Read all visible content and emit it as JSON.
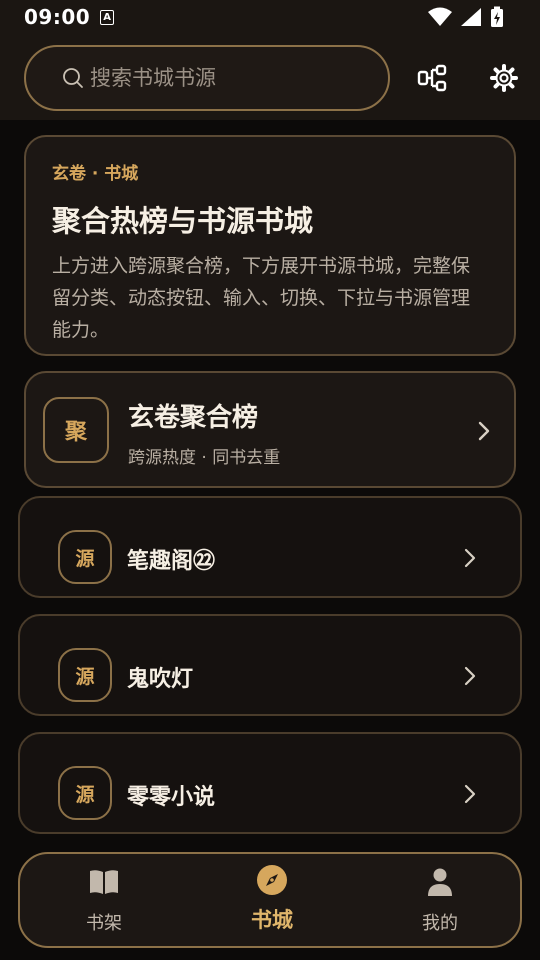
{
  "status_bar": {
    "time": "09:00",
    "a_icon_glyph": "A"
  },
  "search": {
    "placeholder": "搜索书城书源"
  },
  "intro": {
    "kicker": "玄卷 · 书城",
    "title": "聚合热榜与书源书城",
    "description": "上方进入跨源聚合榜，下方展开书源书城，完整保留分类、动态按钮、输入、切换、下拉与书源管理能力。"
  },
  "aggregate": {
    "badge": "聚",
    "title": "玄卷聚合榜",
    "subtitle": "跨源热度 · 同书去重"
  },
  "sources": [
    {
      "badge": "源",
      "name": "笔趣阁㉒"
    },
    {
      "badge": "源",
      "name": "鬼吹灯"
    },
    {
      "badge": "源",
      "name": "零零小说"
    }
  ],
  "nav": {
    "items": [
      {
        "label": "书架",
        "icon": "book-open-icon"
      },
      {
        "label": "书城",
        "icon": "compass-icon",
        "active": true
      },
      {
        "label": "我的",
        "icon": "person-icon"
      }
    ]
  },
  "colors": {
    "background": "#0c0a09",
    "accent": "#d6a75d",
    "border": "#8c7148",
    "card": "#1c1714"
  }
}
